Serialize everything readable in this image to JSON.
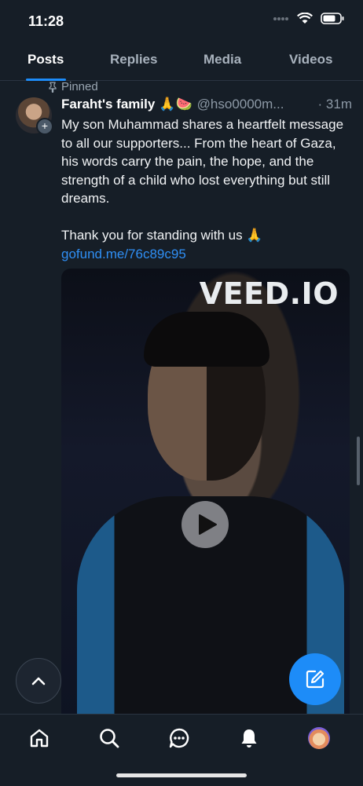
{
  "status": {
    "time": "11:28"
  },
  "tabs": [
    {
      "label": "Posts",
      "active": true
    },
    {
      "label": "Replies",
      "active": false
    },
    {
      "label": "Media",
      "active": false
    },
    {
      "label": "Videos",
      "active": false
    }
  ],
  "post": {
    "pinned_label": "Pinned",
    "author": "Faraht's family",
    "author_emoji": "🙏🍉",
    "handle": "@hso0000m...",
    "time": "· 31m",
    "text_line_1": "My son Muhammad shares a heartfelt message to all our supporters... From the heart of Gaza, his words carry the pain, the hope, and the strength of a child who lost everything but still dreams.",
    "text_line_2": "Thank you for standing with us 🙏",
    "link": "gofund.me/76c89c95",
    "video_watermark": "VEED.IO"
  },
  "icons": {
    "pin": "pin-icon",
    "play": "play-icon",
    "scroll_up": "chevron-up-icon",
    "compose": "compose-icon",
    "nav": [
      "home-icon",
      "search-icon",
      "chat-icon",
      "bell-icon",
      "profile-avatar"
    ]
  },
  "colors": {
    "accent": "#1d8cf8",
    "background": "#161e27",
    "link": "#2f8ff5"
  }
}
